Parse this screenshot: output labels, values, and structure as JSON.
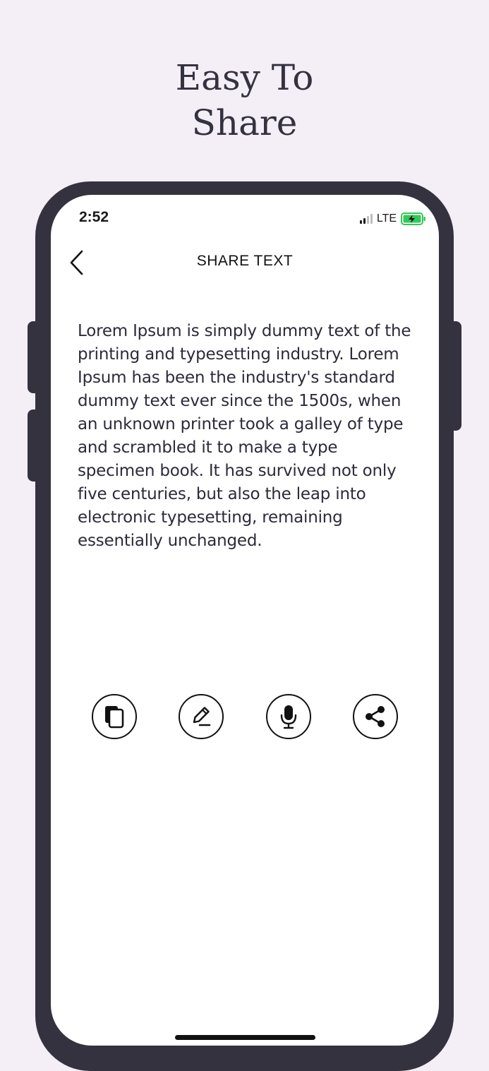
{
  "promo": {
    "line1": "Easy To",
    "line2": "Share"
  },
  "status_bar": {
    "time": "2:52",
    "network": "LTE"
  },
  "nav": {
    "title": "SHARE TEXT"
  },
  "content": {
    "text": "Lorem Ipsum is simply dummy text of the printing and typesetting industry. Lorem Ipsum has been the industry's standard dummy text ever since the 1500s, when an unknown printer took a galley of type and scrambled it to make a type specimen book. It has survived not only five centuries, but also the leap into electronic typesetting, remaining essentially unchanged."
  },
  "actions": [
    {
      "icon": "copy-icon"
    },
    {
      "icon": "edit-icon"
    },
    {
      "icon": "microphone-icon"
    },
    {
      "icon": "share-icon"
    }
  ],
  "colors": {
    "background": "#f4eef7",
    "frame": "#34323f",
    "text": "#2d2a3a",
    "battery": "#35c759"
  }
}
